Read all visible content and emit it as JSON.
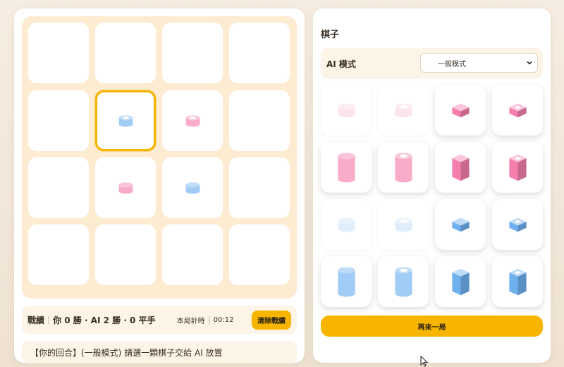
{
  "board": {
    "cells": [
      {
        "piece": "",
        "selected": false
      },
      {
        "piece": "",
        "selected": false
      },
      {
        "piece": "",
        "selected": false
      },
      {
        "piece": "",
        "selected": false
      },
      {
        "piece": "",
        "selected": false
      },
      {
        "piece": "blue-short-cylinder-hole",
        "selected": true
      },
      {
        "piece": "pink-short-cylinder-hole",
        "selected": false
      },
      {
        "piece": "",
        "selected": false
      },
      {
        "piece": "",
        "selected": false
      },
      {
        "piece": "pink-short-cylinder",
        "selected": false
      },
      {
        "piece": "blue-short-cylinder",
        "selected": false
      },
      {
        "piece": "",
        "selected": false
      },
      {
        "piece": "",
        "selected": false
      },
      {
        "piece": "",
        "selected": false
      },
      {
        "piece": "",
        "selected": false
      },
      {
        "piece": "",
        "selected": false
      }
    ]
  },
  "stats": {
    "label": "戰績",
    "record": "你 0 勝 · AI 2 勝 · 0 平手",
    "timer_label": "本局計時",
    "timer_value": "00:12",
    "clear_label": "清除戰績"
  },
  "status": {
    "message": "【你的回合】(一般模式) 請選一顆棋子交給 AI 放置"
  },
  "pieces_panel": {
    "title": "棋子",
    "ai_mode_label": "AI 模式",
    "ai_mode_selected": "一般模式",
    "restart_label": "再來一局",
    "pieces": [
      {
        "id": "pink-short-cylinder",
        "available": false
      },
      {
        "id": "pink-short-cylinder-hole",
        "available": false
      },
      {
        "id": "pink-short-cube",
        "available": true
      },
      {
        "id": "pink-short-cube-hole",
        "available": true
      },
      {
        "id": "pink-tall-cylinder",
        "available": true
      },
      {
        "id": "pink-tall-cylinder-hole",
        "available": true
      },
      {
        "id": "pink-tall-cube",
        "available": true
      },
      {
        "id": "pink-tall-cube-hole",
        "available": true
      },
      {
        "id": "blue-short-cylinder",
        "available": false
      },
      {
        "id": "blue-short-cylinder-hole",
        "available": false
      },
      {
        "id": "blue-short-cube",
        "available": true
      },
      {
        "id": "blue-short-cube-hole",
        "available": true
      },
      {
        "id": "blue-tall-cylinder",
        "available": true
      },
      {
        "id": "blue-tall-cylinder-hole",
        "available": true
      },
      {
        "id": "blue-tall-cube",
        "available": true
      },
      {
        "id": "blue-tall-cube-hole",
        "available": true
      }
    ]
  },
  "colors": {
    "pink": "#f47fac",
    "blue": "#6fb0ef",
    "accent": "#f7b500"
  }
}
